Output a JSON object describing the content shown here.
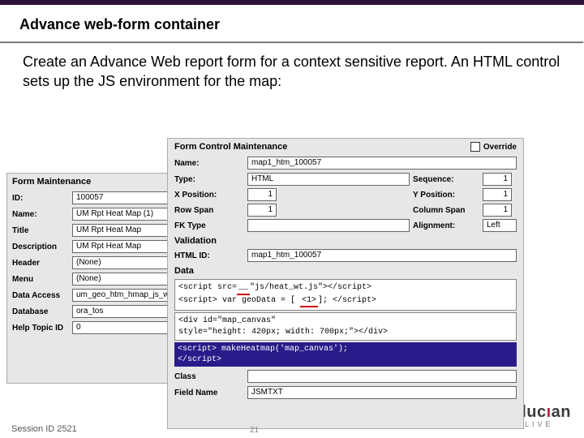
{
  "topbar_color": "#2e1235",
  "slide": {
    "title": "Advance web-form container",
    "lead": "Create an Advance Web report form for a context sensitive report. An HTML control sets up the JS environment for the map:"
  },
  "form_maintenance": {
    "heading": "Form Maintenance",
    "labels": {
      "id": "ID:",
      "name": "Name:",
      "title": "Title",
      "desc": "Description",
      "header": "Header",
      "menu": "Menu",
      "data": "Data Access",
      "db": "Database",
      "help": "Help Topic ID"
    },
    "values": {
      "id": "100057",
      "name": "UM Rpt Heat Map (1)",
      "title": "UM Rpt Heat Map",
      "desc": "UM Rpt Heat Map",
      "header": "(None)",
      "menu": "(None)",
      "data": "um_geo_htm_hmap_js_wkeys",
      "db": "ora_tos",
      "help": "0"
    }
  },
  "form_control": {
    "heading": "Form Control Maintenance",
    "override": "Override",
    "labels": {
      "name": "Name:",
      "type": "Type:",
      "seq": "Sequence:",
      "xpos": "X Position:",
      "ypos": "Y Position:",
      "rowspan": "Row Span",
      "colspan": "Column Span",
      "fktype": "FK Type",
      "align": "Alignment:",
      "validation": "Validation",
      "htmlid": "HTML ID:",
      "data": "Data",
      "class": "Class",
      "fieldname": "Field Name"
    },
    "values": {
      "name": "map1_htm_100057",
      "type": "HTML",
      "seq": "1",
      "xpos": "1",
      "ypos": "1",
      "rowspan": "1",
      "colspan": "1",
      "fktype": "",
      "align": "Left",
      "htmlid": "map1_htm_100057",
      "class": "",
      "fieldname": "JSMTXT"
    },
    "data_block": {
      "line1a": "<script src=",
      "line1_red": "__",
      "line1b": "\"js/heat_wt.js\"></script>",
      "line2a": "<script> var geoData = [ ",
      "line2_red": "<1>",
      "line2b": "]; </script>",
      "line3": "<div id=\"map_canvas\"",
      "line4": "style=\"height: 420px; width: 700px;\"></div>"
    },
    "hilite": {
      "l1": "<script> makeHeatmap('map_canvas');",
      "l2": "</script>"
    }
  },
  "footer": {
    "session": "Session ID 2521",
    "page": "21"
  },
  "brand": {
    "name1": "elluc",
    "name2": "ı",
    "name3": "an",
    "sub": "LIVE"
  },
  "deco_colors": [
    "#d6d0d8",
    "#c8bfca",
    "#b4a7b9",
    "#a596aa",
    "#96869b",
    "#87768c",
    "#73617a",
    "#5c4a65",
    "#46344f",
    "#2e1235"
  ]
}
